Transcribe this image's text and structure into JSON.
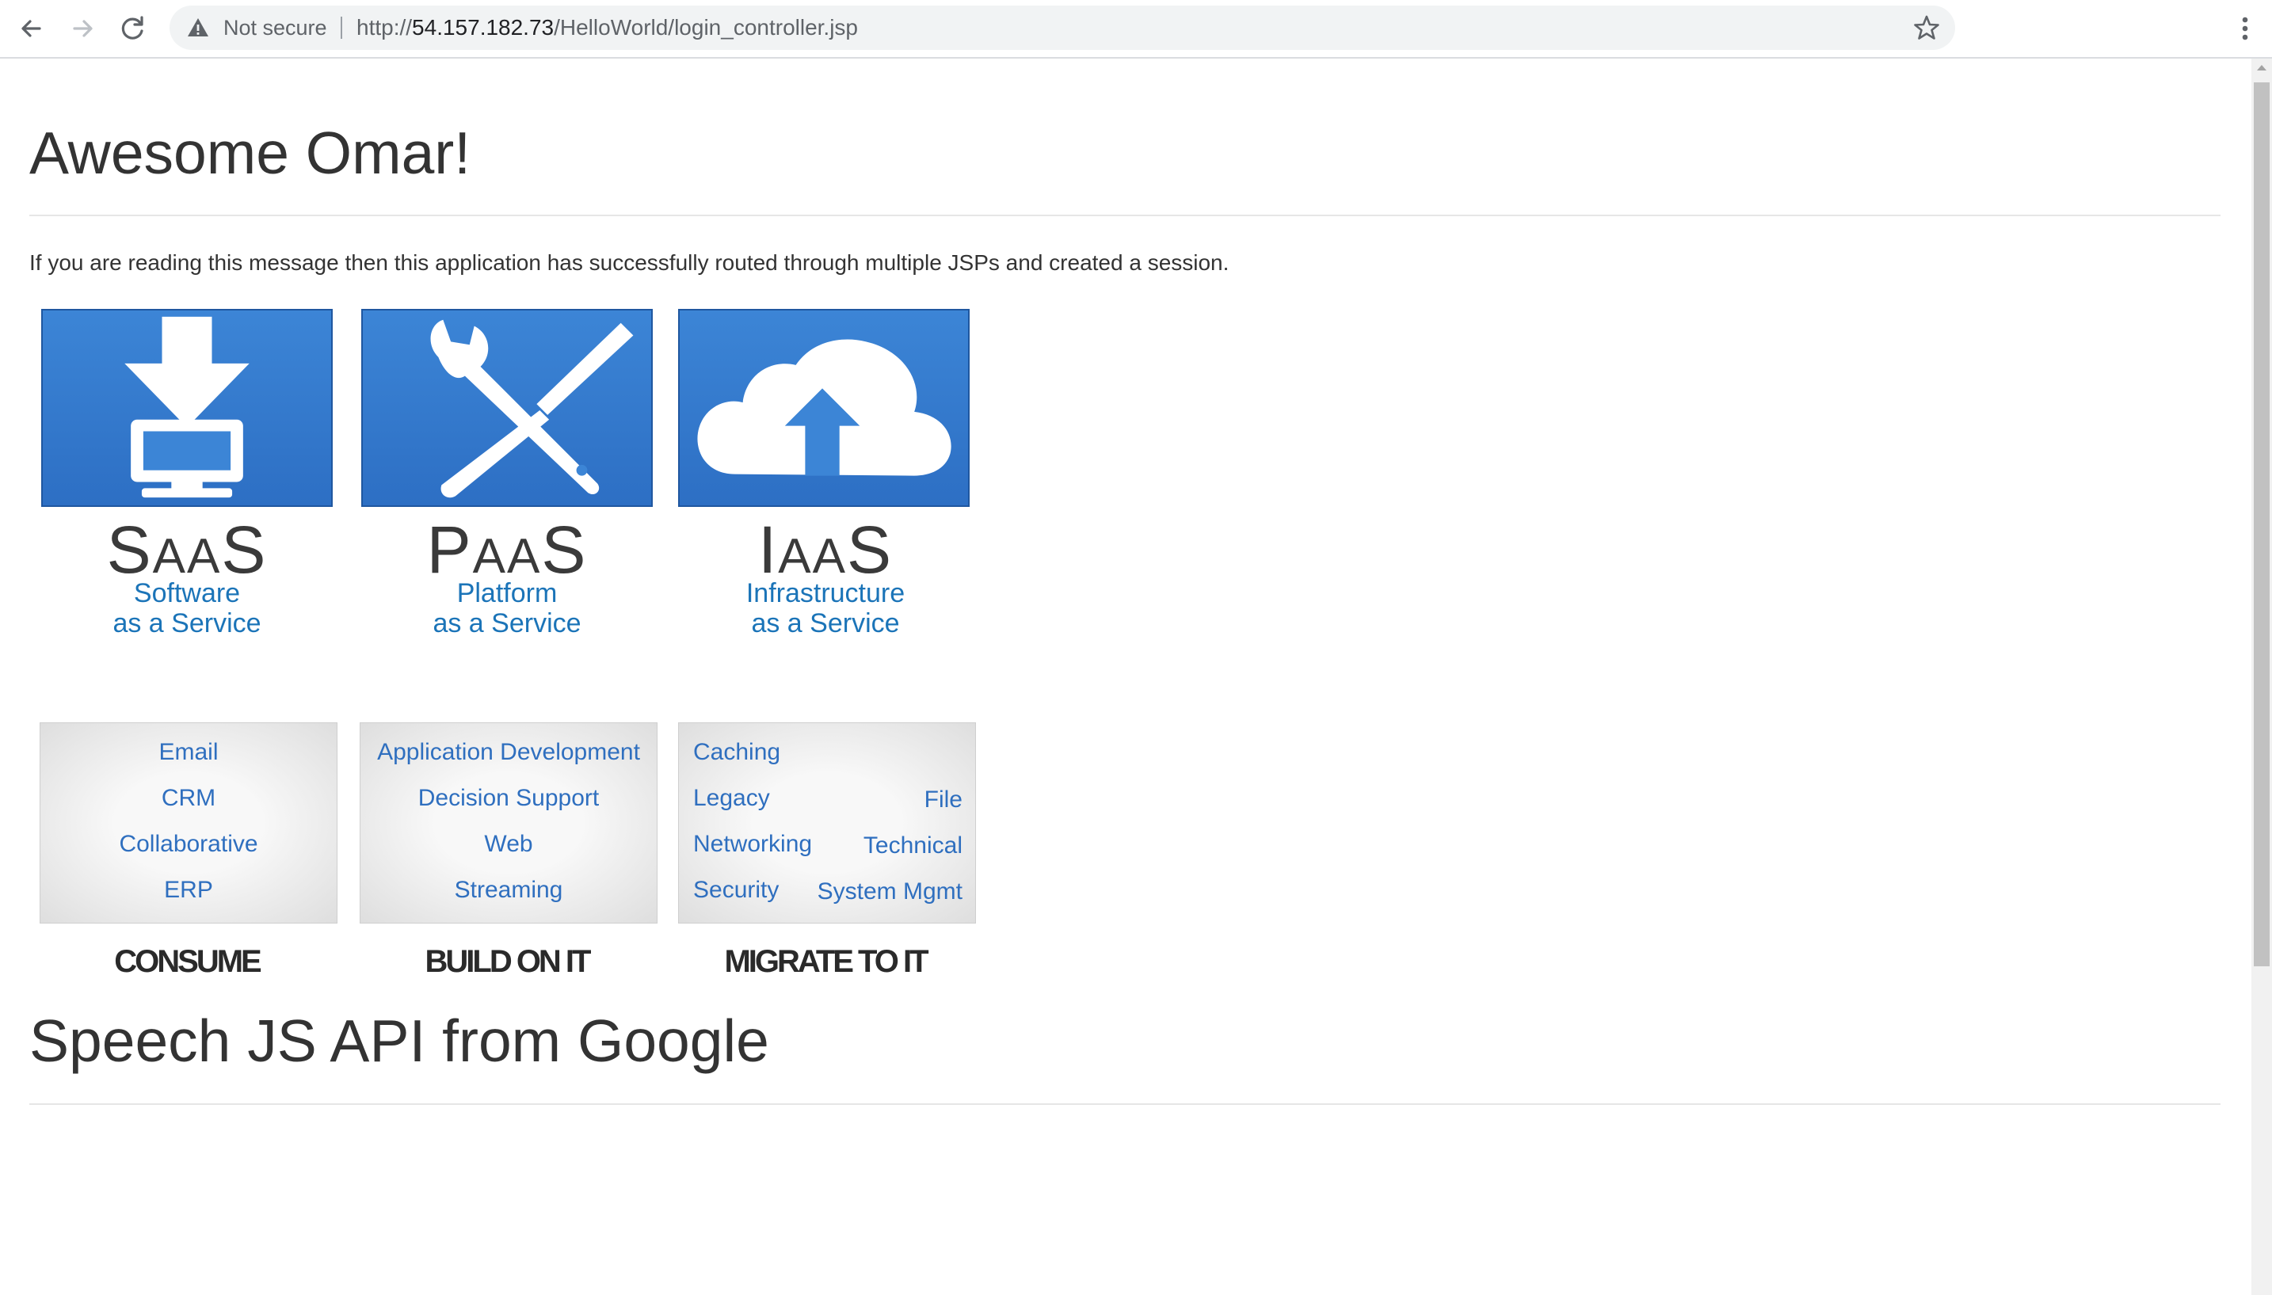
{
  "browser": {
    "back_icon": "arrow-left-icon",
    "forward_icon": "arrow-right-icon",
    "reload_icon": "reload-icon",
    "security_label": "Not secure",
    "url_prefix": "http://",
    "url_host": "54.157.182.73",
    "url_path": "/HelloWorld/login_controller.jsp",
    "star_icon": "star-icon",
    "menu_icon": "kebab-menu-icon"
  },
  "page": {
    "heading": "Awesome Omar!",
    "intro": "If you are reading this message then this application has successfully routed through multiple JSPs and created a session.",
    "section_heading": "Speech JS API from Google"
  },
  "cloud_image": {
    "colors": {
      "tile_blue": "#2d6fc4",
      "service_text": "#1b74b8",
      "item_text": "#2f6fbf"
    },
    "columns": [
      {
        "acronym_big": "S",
        "acronym_small": "AA",
        "acronym_end": "S",
        "service_line1": "Software",
        "service_line2": "as a Service",
        "items": [
          "Email",
          "CRM",
          "Collaborative",
          "ERP"
        ],
        "action": "CONSUME",
        "icon": "download-monitor-icon"
      },
      {
        "acronym_big": "P",
        "acronym_small": "AA",
        "acronym_end": "S",
        "service_line1": "Platform",
        "service_line2": "as a Service",
        "items": [
          "Application Development",
          "Decision Support",
          "Web",
          "Streaming"
        ],
        "action": "BUILD ON IT",
        "icon": "wrench-screwdriver-icon"
      },
      {
        "acronym_big": "I",
        "acronym_small": "AA",
        "acronym_end": "S",
        "service_line1": "Infrastructure",
        "service_line2": "as a Service",
        "items_left": [
          "Caching",
          "Legacy",
          "Networking",
          "Security"
        ],
        "items_right": [
          "File",
          "Technical",
          "System Mgmt"
        ],
        "action": "MIGRATE TO IT",
        "icon": "cloud-upload-icon"
      }
    ]
  }
}
